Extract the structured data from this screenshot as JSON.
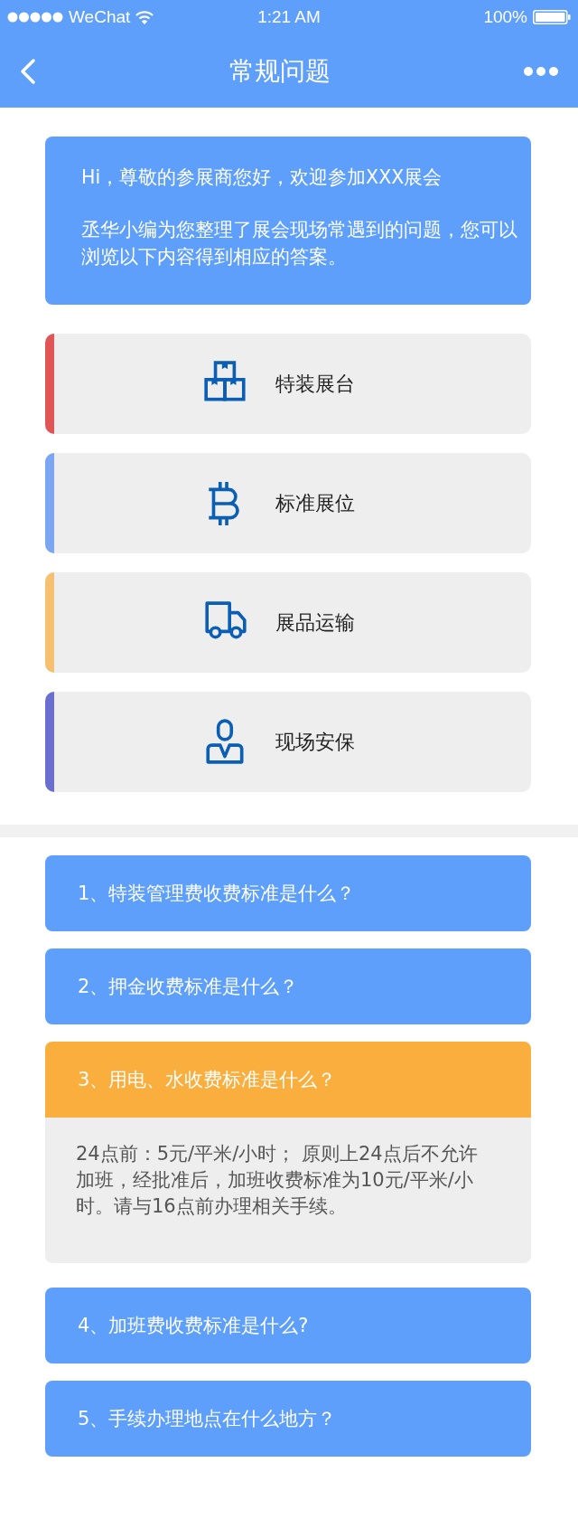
{
  "status_bar": {
    "carrier": "WeChat",
    "time": "1:21 AM",
    "battery": "100%"
  },
  "nav_bar": {
    "title": "常规问题"
  },
  "intro": {
    "greeting": "Hi，尊敬的参展商您好，欢迎参加XXX展会",
    "message": "丞华小编为您整理了展会现场常遇到的问题，您可以浏览以下内容得到相应的答案。"
  },
  "categories": [
    {
      "label": "特装展台",
      "kind": "boxes",
      "color": "#e05555"
    },
    {
      "label": "标准展位",
      "kind": "bitcoin",
      "color": "#7ba6f2"
    },
    {
      "label": "展品运输",
      "kind": "truck",
      "color": "#f6c070"
    },
    {
      "label": "现场安保",
      "kind": "person",
      "color": "#6a6fcf"
    }
  ],
  "faq": [
    {
      "question": "1、特装管理费收费标准是什么？",
      "expanded": false
    },
    {
      "question": "2、押金收费标准是什么？",
      "expanded": false
    },
    {
      "question": "3、用电、水收费标准是什么？",
      "expanded": true,
      "answer": "24点前：5元/平米/小时； 原则上24点后不允许加班，经批准后，加班收费标准为10元/平米/小时。请与16点前办理相关手续。"
    },
    {
      "question": "4、加班费收费标准是什么?",
      "expanded": false
    },
    {
      "question": "5、手续办理地点在什么地方？",
      "expanded": false
    }
  ]
}
